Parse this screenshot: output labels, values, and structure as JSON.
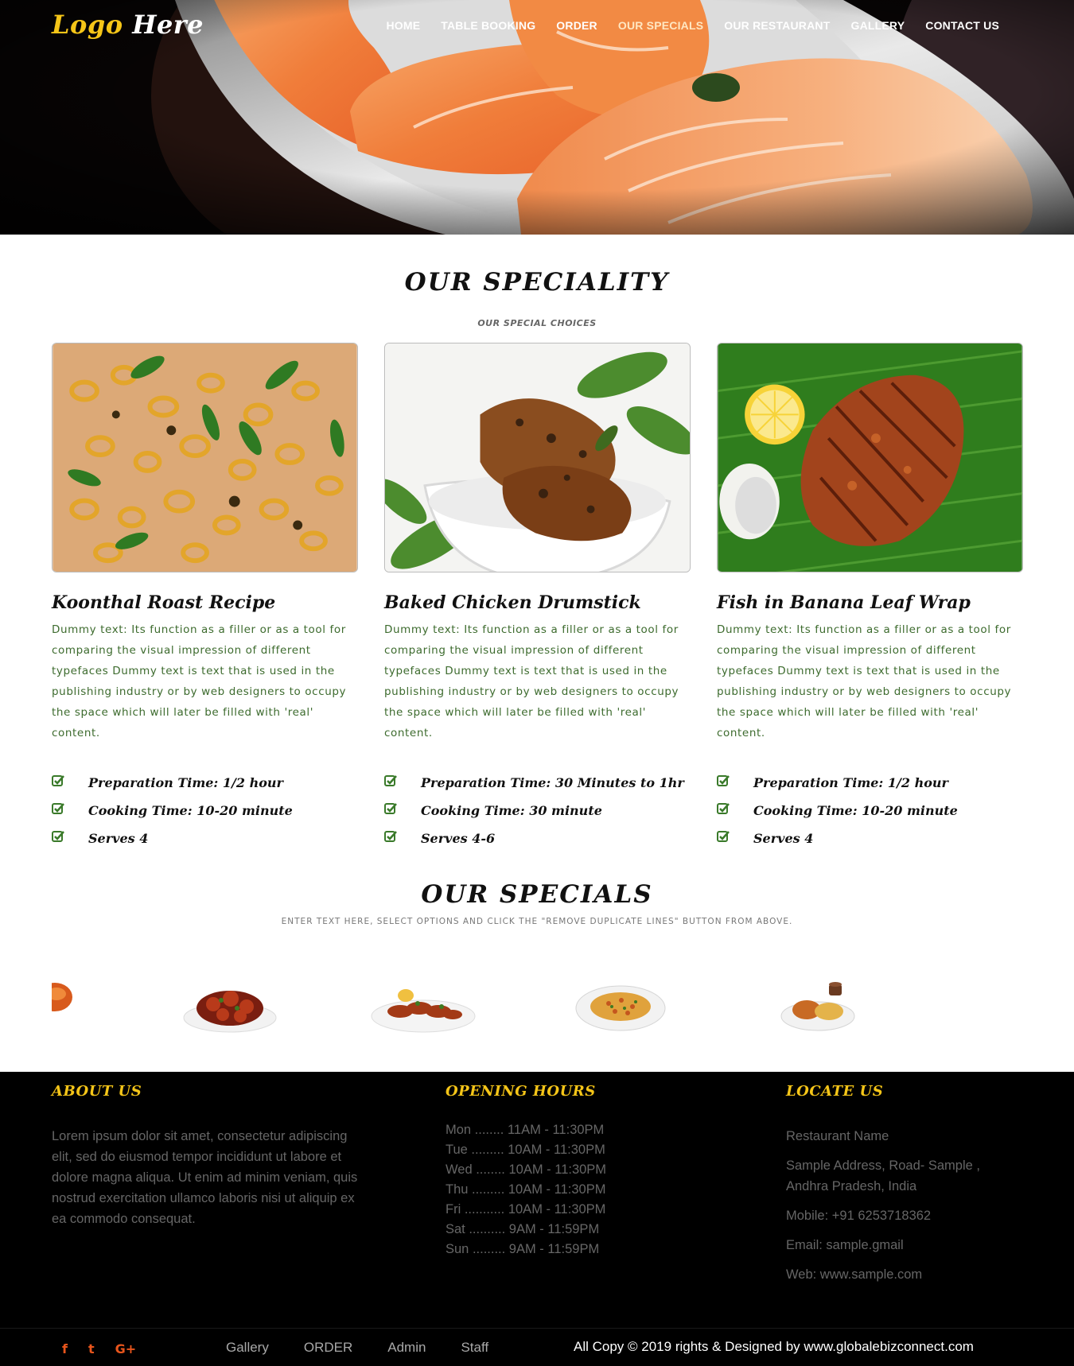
{
  "header": {
    "logo_part1": "Logo",
    "logo_part2": "Here",
    "nav": [
      {
        "label": "HOME"
      },
      {
        "label": "TABLE BOOKING"
      },
      {
        "label": "ORDER"
      },
      {
        "label": "OUR SPECIALS"
      },
      {
        "label": "OUR RESTAURANT"
      },
      {
        "label": "GALLERY"
      },
      {
        "label": "CONTACT US"
      }
    ]
  },
  "speciality": {
    "title": "OUR SPECIALITY",
    "subtitle": "OUR SPECIAL CHOICES",
    "cards": [
      {
        "title": "Koonthal Roast Recipe",
        "description": "Dummy text: Its function as a filler or as a tool for comparing the visual impression of different typefaces Dummy text is text that is used in the publishing industry or by web designers to occupy the space which will later be filled with 'real' content.",
        "facts": [
          "Preparation Time: 1/2 hour",
          "Cooking Time: 10-20 minute",
          "Serves 4"
        ]
      },
      {
        "title": "Baked Chicken Drumstick",
        "description": "Dummy text: Its function as a filler or as a tool for comparing the visual impression of different typefaces Dummy text is text that is used in the publishing industry or by web designers to occupy the space which will later be filled with 'real' content.",
        "facts": [
          "Preparation Time: 30 Minutes to 1hr",
          "Cooking Time: 30 minute",
          "Serves 4-6"
        ]
      },
      {
        "title": "Fish in Banana Leaf Wrap",
        "description": "Dummy text: Its function as a filler or as a tool for comparing the visual impression of different typefaces Dummy text is text that is used in the publishing industry or by web designers to occupy the space which will later be filled with 'real' content.",
        "facts": [
          "Preparation Time: 1/2 hour",
          "Cooking Time: 10-20 minute",
          "Serves 4"
        ]
      }
    ]
  },
  "specials": {
    "title": "OUR SPECIALS",
    "subtitle": "ENTER TEXT HERE, SELECT OPTIONS AND CLICK THE \"REMOVE DUPLICATE LINES\" BUTTON FROM ABOVE."
  },
  "footer": {
    "about": {
      "heading": "ABOUT US",
      "text": "Lorem ipsum dolor sit amet, consectetur adipiscing elit, sed do eiusmod tempor incididunt ut labore et dolore magna aliqua. Ut enim ad minim veniam, quis nostrud exercitation ullamco laboris nisi ut aliquip ex ea commodo consequat."
    },
    "hours": {
      "heading": "OPENING HOURS",
      "rows": [
        "Mon ........ 11AM - 11:30PM",
        "Tue ......... 10AM - 11:30PM",
        "Wed ........ 10AM - 11:30PM",
        "Thu ......... 10AM - 11:30PM",
        "Fri ........... 10AM - 11:30PM",
        "Sat .......... 9AM - 11:59PM",
        "Sun ......... 9AM - 11:59PM"
      ]
    },
    "locate": {
      "heading": "LOCATE US",
      "name": "Restaurant Name",
      "address": "Sample Address, Road- Sample , Andhra Pradesh, India",
      "mobile": "Mobile: +91 6253718362",
      "email": "Email: sample.gmail",
      "web": "Web: www.sample.com"
    },
    "social": {
      "facebook": "f",
      "twitter": "t",
      "google_plus": "G+"
    },
    "links": [
      {
        "label": "Gallery"
      },
      {
        "label": "ORDER"
      },
      {
        "label": "Admin"
      },
      {
        "label": "Staff"
      }
    ],
    "copyright": "All Copy © 2019 rights & Designed by www.globalebizconnect.com"
  },
  "icons": {
    "check": "check-square-icon",
    "facebook": "facebook-icon",
    "twitter": "twitter-icon",
    "google_plus": "google-plus-icon"
  },
  "colors": {
    "logo_accent": "#f5c518",
    "footer_heading": "#f5c518",
    "description_text": "#3d6b2e",
    "check_icon": "#3a7a2a",
    "social_icon": "#e8551c"
  }
}
